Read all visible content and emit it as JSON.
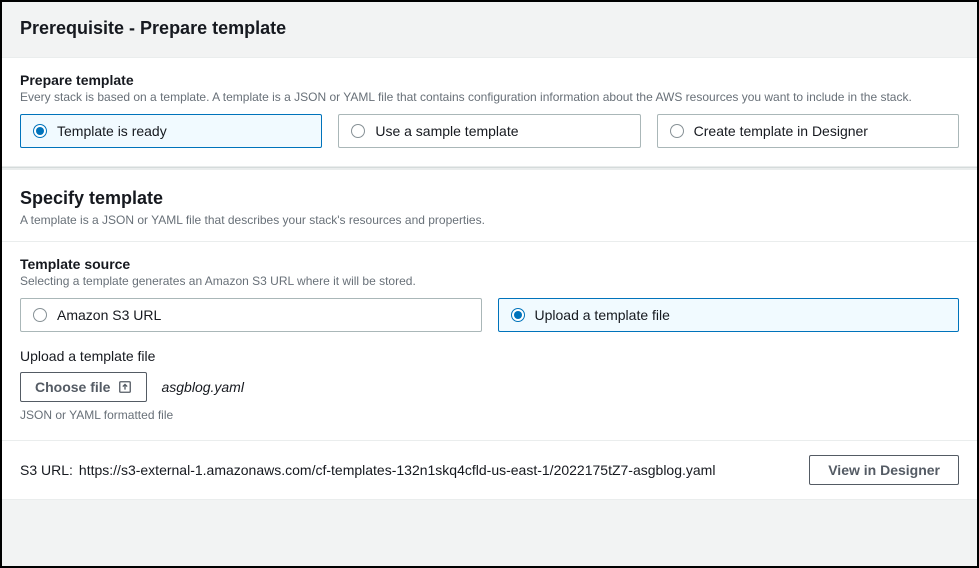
{
  "page": {
    "title": "Prerequisite - Prepare template"
  },
  "prepare": {
    "title": "Prepare template",
    "description": "Every stack is based on a template. A template is a JSON or YAML file that contains configuration information about the AWS resources you want to include in the stack.",
    "options": [
      {
        "label": "Template is ready",
        "selected": true
      },
      {
        "label": "Use a sample template",
        "selected": false
      },
      {
        "label": "Create template in Designer",
        "selected": false
      }
    ]
  },
  "specify": {
    "title": "Specify template",
    "description": "A template is a JSON or YAML file that describes your stack's resources and properties."
  },
  "source": {
    "title": "Template source",
    "description": "Selecting a template generates an Amazon S3 URL where it will be stored.",
    "options": [
      {
        "label": "Amazon S3 URL",
        "selected": false
      },
      {
        "label": "Upload a template file",
        "selected": true
      }
    ]
  },
  "upload": {
    "label": "Upload a template file",
    "choose_button": "Choose file",
    "filename": "asgblog.yaml",
    "hint": "JSON or YAML formatted file"
  },
  "footer": {
    "s3_label": "S3 URL:",
    "s3_url": "https://s3-external-1.amazonaws.com/cf-templates-132n1skq4cfld-us-east-1/2022175tZ7-asgblog.yaml",
    "view_button": "View in Designer"
  }
}
